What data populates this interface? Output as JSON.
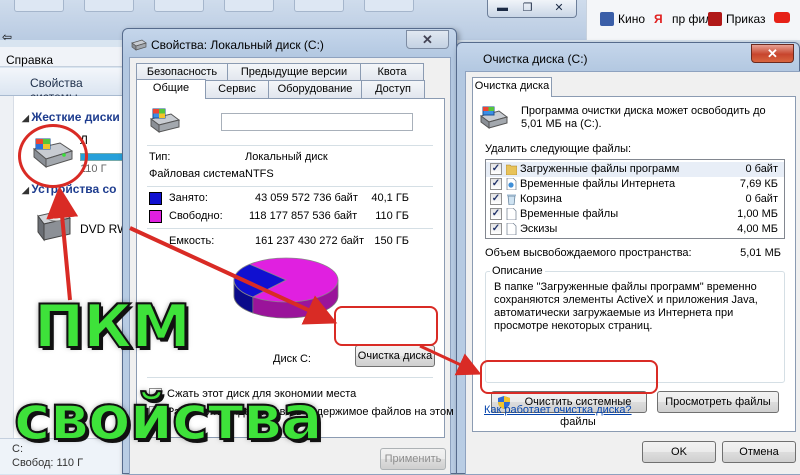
{
  "background_window": {
    "menu": "Справка",
    "toolbar_button": "Свойства системы",
    "nav_section": "Жесткие диски",
    "drive_label": "Л",
    "drive_size": "110 Г",
    "removable_section": "Устройства со",
    "dvd_label": "DVD RW",
    "status_c": "C:",
    "status_free": "Свобод",
    "status_size": "110 Г"
  },
  "browser_bookmarks": [
    {
      "label": "Кино",
      "color": "#3a5ea8"
    },
    {
      "label": "пр фил",
      "color": "#e02020"
    },
    {
      "label": "Приказ",
      "color": "#b01818"
    },
    {
      "label": "",
      "color": "#e62117"
    }
  ],
  "properties": {
    "title": "Свойства: Локальный диск (C:)",
    "tabs_back": [
      "Безопасность",
      "Предыдущие версии",
      "Квота"
    ],
    "tabs_front": [
      "Общие",
      "Сервис",
      "Оборудование",
      "Доступ"
    ],
    "selected_tab": "Общие",
    "name_value": "",
    "type_label": "Тип:",
    "type_value": "Локальный диск",
    "fs_label": "Файловая система:",
    "fs_value": "NTFS",
    "used_label": "Занято:",
    "used_bytes": "43 059 572 736 байт",
    "used_gb": "40,1 ГБ",
    "free_label": "Свободно:",
    "free_bytes": "118 177 857 536 байт",
    "free_gb": "110 ГБ",
    "capacity_label": "Емкость:",
    "capacity_bytes": "161 237 430 272 байт",
    "capacity_gb": "150 ГБ",
    "disk_label": "Диск C:",
    "cleanup_button": "Очистка диска",
    "compress_label": "Сжать этот диск для экономии места",
    "index_label": "Разрешить индексировать содержимое файлов на этом",
    "apply_button": "Применить",
    "used_color": "#1010d0",
    "free_color": "#e020e0",
    "used_fraction": 0.267
  },
  "cleanup": {
    "title": "Очистка диска  (C:)",
    "tab": "Очистка диска",
    "intro": "Программа очистки диска может освободить до 5,01 МБ на  (C:).",
    "delete_label": "Удалить следующие файлы:",
    "files": [
      {
        "name": "Загруженные файлы программ",
        "size": "0 байт",
        "checked": true,
        "selected": true
      },
      {
        "name": "Временные файлы Интернета",
        "size": "7,69 КБ",
        "checked": true,
        "selected": false
      },
      {
        "name": "Корзина",
        "size": "0 байт",
        "checked": true,
        "selected": false
      },
      {
        "name": "Временные файлы",
        "size": "1,00 МБ",
        "checked": true,
        "selected": false
      },
      {
        "name": "Эскизы",
        "size": "4,00 МБ",
        "checked": true,
        "selected": false
      }
    ],
    "total_label": "Объем высвобождаемого пространства:",
    "total_value": "5,01 МБ",
    "desc_title": "Описание",
    "desc_text": "В папке \"Загруженные файлы программ\" временно сохраняются элементы ActiveX и приложения Java, автоматически загружаемые из Интернета при просмотре некоторых страниц.",
    "system_button": "Очистить системные файлы",
    "view_button": "Просмотреть файлы",
    "link": "Как работает очистка диска?",
    "ok_button": "OK",
    "cancel_button": "Отмена"
  },
  "overlay": {
    "word1": "ПКМ",
    "word2": "свойства"
  }
}
